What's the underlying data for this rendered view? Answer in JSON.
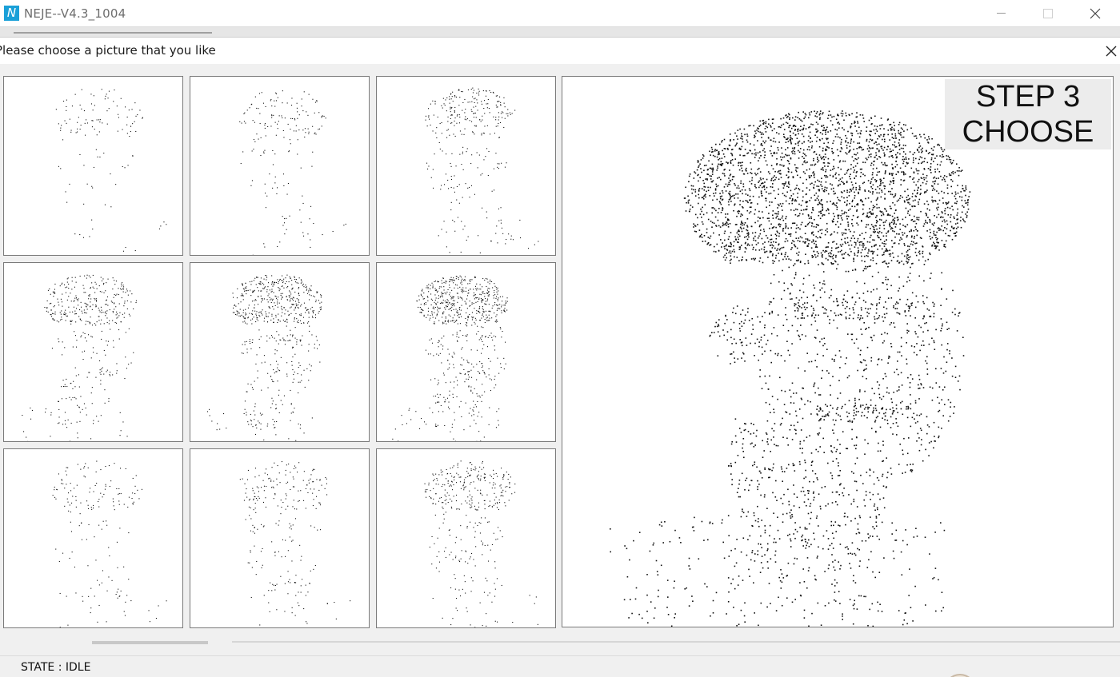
{
  "window": {
    "icon_letter": "N",
    "title": "NEJE--V4.3_1004"
  },
  "dialog": {
    "title": "Please choose a picture that you like",
    "step_line1": "STEP 3",
    "step_line2": "CHOOSE"
  },
  "thumbnails": [
    {
      "name": "thumb-1",
      "ink": 0.15,
      "pose": "right"
    },
    {
      "name": "thumb-2",
      "ink": 0.22,
      "pose": "right"
    },
    {
      "name": "thumb-3",
      "ink": 0.38,
      "pose": "right"
    },
    {
      "name": "thumb-4",
      "ink": 0.55,
      "pose": "left"
    },
    {
      "name": "thumb-5",
      "ink": 0.72,
      "pose": "left"
    },
    {
      "name": "thumb-6",
      "ink": 0.92,
      "pose": "left"
    },
    {
      "name": "thumb-7",
      "ink": 0.2,
      "pose": "right"
    },
    {
      "name": "thumb-8",
      "ink": 0.3,
      "pose": "right"
    },
    {
      "name": "thumb-9",
      "ink": 0.45,
      "pose": "right"
    }
  ],
  "status": {
    "text": "STATE : IDLE"
  },
  "colors": {
    "accent": "#1aa0d8",
    "ink": "#111111",
    "frame": "#7a7a7a"
  }
}
